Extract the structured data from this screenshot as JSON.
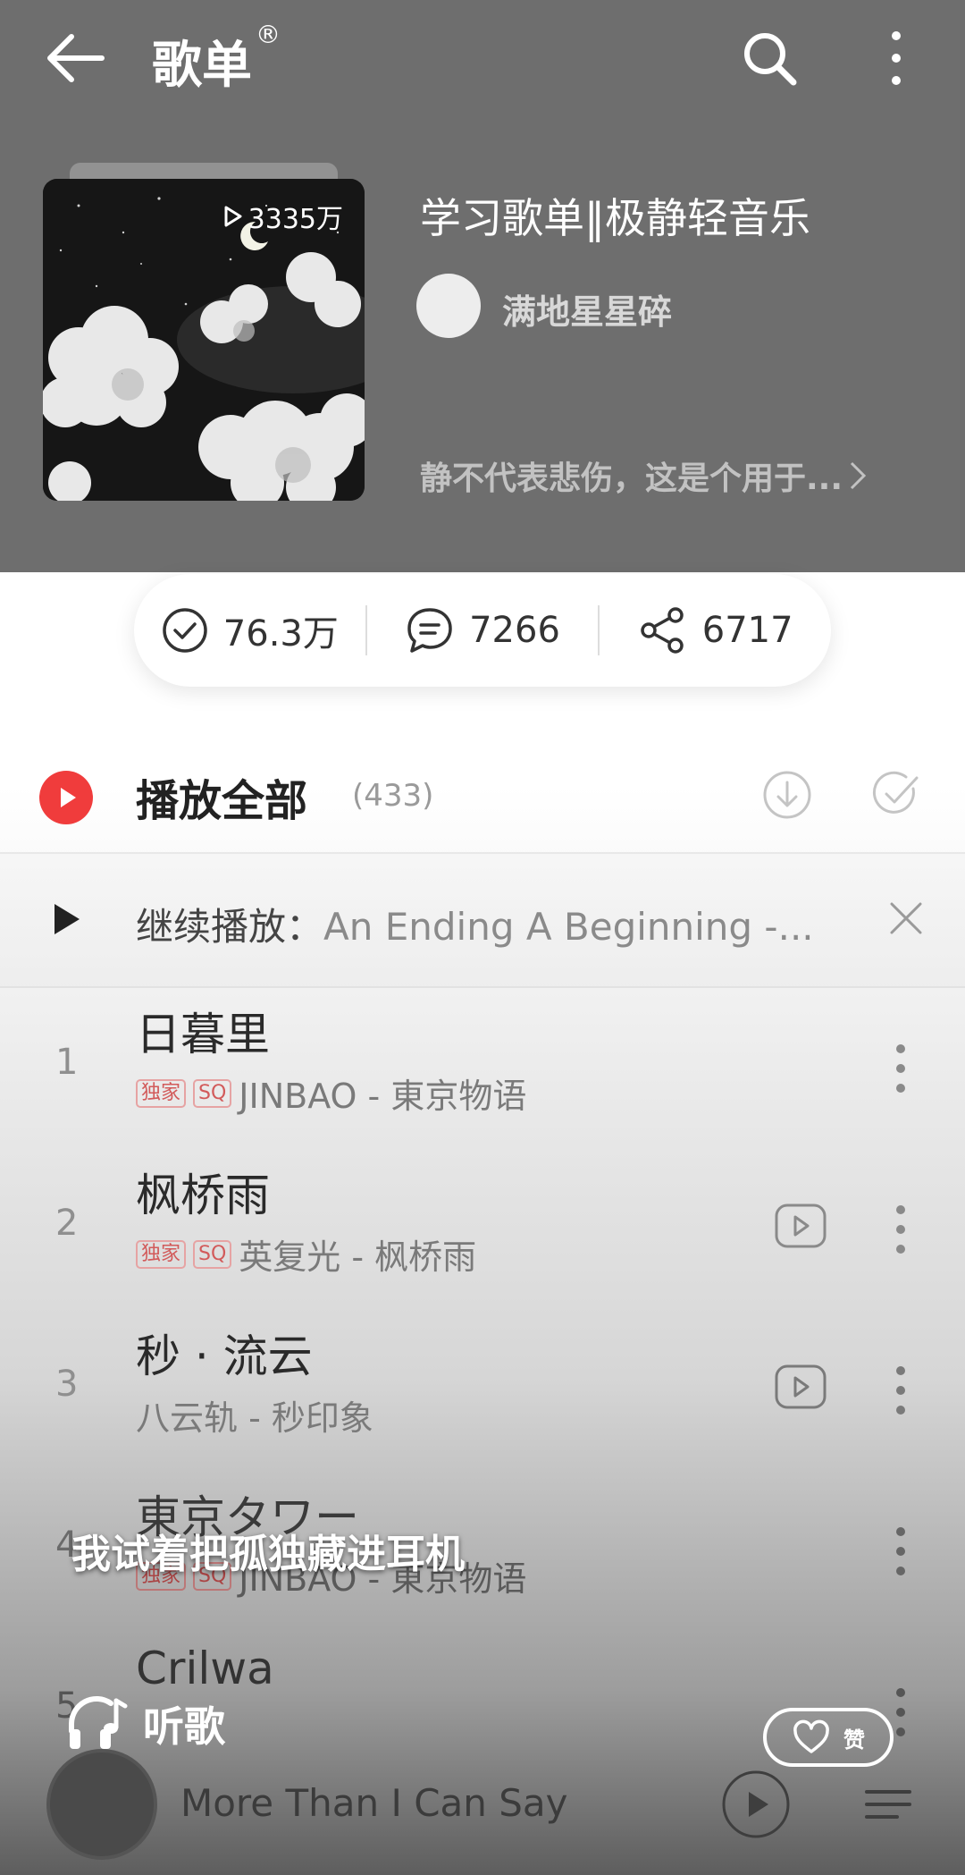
{
  "header": {
    "title": "歌单",
    "title_mark": "®"
  },
  "playlist": {
    "play_count": "3335万",
    "title": "学习歌单‖极静轻音乐",
    "creator": "满地星星碎",
    "description": "静不代表悲伤，这是个用于..."
  },
  "stats": {
    "favorites": "76.3万",
    "comments": "7266",
    "shares": "6717"
  },
  "play_all": {
    "label": "播放全部",
    "count": "(433)"
  },
  "resume": {
    "prefix": "继续播放：",
    "song": "An Ending A Beginning -..."
  },
  "songs": [
    {
      "num": "1",
      "title": "日暮里",
      "badges": [
        "独家",
        "SQ"
      ],
      "subtitle": "JINBAO - 東京物语"
    },
    {
      "num": "2",
      "title": "枫桥雨",
      "badges": [
        "独家",
        "SQ"
      ],
      "subtitle": "英复光 - 枫桥雨"
    },
    {
      "num": "3",
      "title": "秒 · 流云",
      "badges": [],
      "subtitle": "八云轨 - 秒印象"
    },
    {
      "num": "4",
      "title": "東京タワー",
      "badges": [
        "独家",
        "SQ"
      ],
      "subtitle": "JINBAO - 東京物语"
    },
    {
      "num": "5",
      "title": "Crilwa",
      "badges": [],
      "subtitle": ""
    }
  ],
  "overlay": {
    "caption": "我试着把孤独藏进耳机",
    "listen_label": "听歌",
    "like_label": "赞"
  },
  "mini_player": {
    "text": "More Than I Can Say"
  },
  "colors": {
    "accent": "#f03c3c",
    "header_bg": "#6e6e6e"
  }
}
